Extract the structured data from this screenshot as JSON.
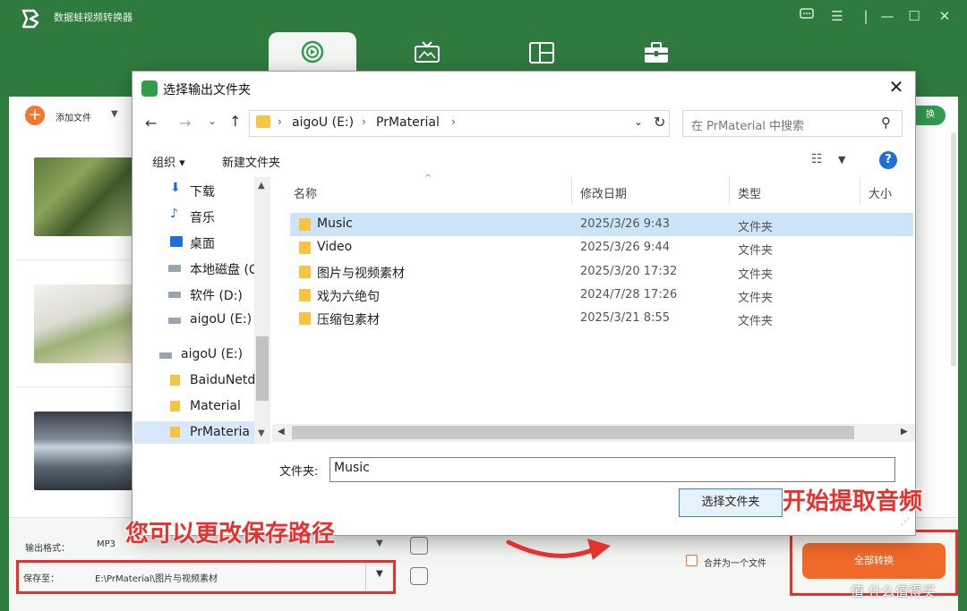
{
  "app": {
    "title": "数据蛙视频转换器",
    "add_file_label": "添加文件",
    "convert_all_small": "换",
    "format_label": "输出格式：",
    "format_value": "MP3",
    "save_label": "保存至：",
    "save_path": "E:\\PrMaterial\\图片与视频素材",
    "merge_label": "合并为一个文件",
    "convert_all_label": "全部转换",
    "tabs": [
      "convert",
      "tv",
      "layout",
      "toolbox"
    ]
  },
  "annotations": {
    "save_hint": "您可以更改保存路径",
    "extract_hint": "开始提取音频",
    "watermark": "值 什么值得买"
  },
  "dialog": {
    "title": "选择输出文件夹",
    "breadcrumb": [
      "aigoU (E:)",
      "PrMaterial"
    ],
    "search_placeholder": "在 PrMaterial 中搜索",
    "organize_label": "组织 ▾",
    "new_folder_label": "新建文件夹",
    "help_label": "?",
    "columns": {
      "name": "名称",
      "date": "修改日期",
      "type": "类型",
      "size": "大小"
    },
    "tree": [
      {
        "label": "下载",
        "icon": "download-icon"
      },
      {
        "label": "音乐",
        "icon": "music-icon"
      },
      {
        "label": "桌面",
        "icon": "desktop-icon"
      },
      {
        "label": "本地磁盘 (C",
        "icon": "drive-icon"
      },
      {
        "label": "软件 (D:)",
        "icon": "drive-icon"
      },
      {
        "label": "aigoU (E:)",
        "icon": "drive-icon"
      },
      {
        "label": "aigoU (E:)",
        "icon": "drive-icon"
      },
      {
        "label": "BaiduNetd",
        "icon": "folder-icon"
      },
      {
        "label": "Material",
        "icon": "folder-icon"
      },
      {
        "label": "PrMateria",
        "icon": "folder-icon"
      }
    ],
    "files": [
      {
        "name": "Music",
        "date": "2025/3/26 9:43",
        "type": "文件夹"
      },
      {
        "name": "Video",
        "date": "2025/3/26 9:44",
        "type": "文件夹"
      },
      {
        "name": "图片与视频素材",
        "date": "2025/3/20 17:32",
        "type": "文件夹"
      },
      {
        "name": "戏为六绝句",
        "date": "2024/7/28 17:26",
        "type": "文件夹"
      },
      {
        "name": "压缩包素材",
        "date": "2025/3/21 8:55",
        "type": "文件夹"
      }
    ],
    "folder_label": "文件夹:",
    "folder_value": "Music",
    "select_button": "选择文件夹"
  },
  "colors": {
    "app_green": "#2f7b3e",
    "accent_orange": "#f26a2a",
    "annotation_red": "#e5322f",
    "selection_blue": "#cce4f7"
  }
}
